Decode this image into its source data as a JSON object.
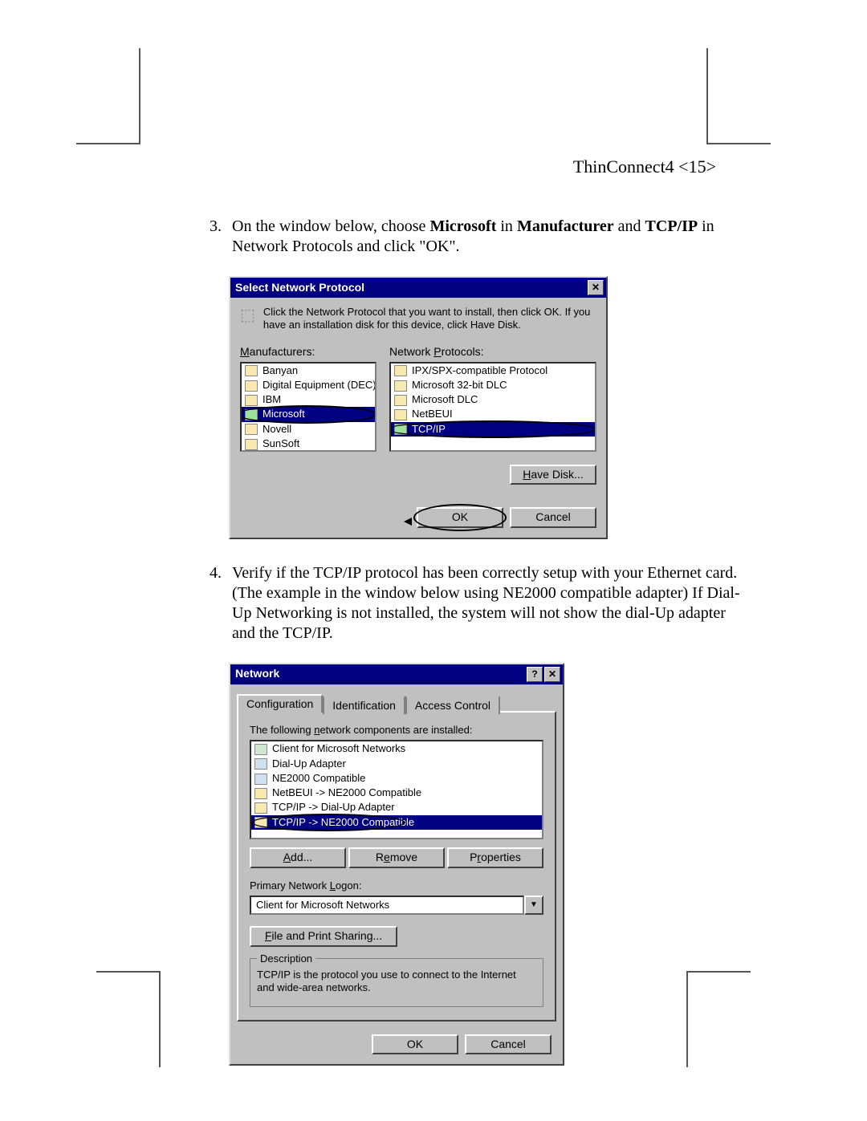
{
  "header": "ThinConnect4  <15>",
  "step3": {
    "num": "3.",
    "text_before": "On the window below, choose ",
    "bold1": "Microsoft",
    "text_mid1": " in ",
    "bold2": "Manufacturer",
    "text_mid2": " and ",
    "bold3": "TCP/IP",
    "text_mid3": " in Network Protocols and click \"OK\"."
  },
  "step4": {
    "text": "Verify if the TCP/IP protocol has been correctly setup with your Ethernet card.   (The example in the window below using NE2000 compatible adapter) If Dial-Up Networking is not installed, the system will not show the dial-Up adapter and the TCP/IP."
  },
  "dlg1": {
    "title": "Select Network Protocol",
    "hint": "Click the Network Protocol that you want to install, then click OK. If you have an installation disk for this device, click Have Disk.",
    "mfg_label": "Manufacturers:",
    "protocols_label": "Network Protocols:",
    "manufacturers": [
      "Banyan",
      "Digital Equipment (DEC)",
      "IBM",
      "Microsoft",
      "Novell",
      "SunSoft"
    ],
    "protocols": [
      "IPX/SPX-compatible Protocol",
      "Microsoft 32-bit DLC",
      "Microsoft DLC",
      "NetBEUI",
      "TCP/IP"
    ],
    "have_disk": "Have Disk...",
    "ok": "OK",
    "cancel": "Cancel"
  },
  "dlg2": {
    "title": "Network",
    "tabs": [
      "Configuration",
      "Identification",
      "Access Control"
    ],
    "list_label": "The following network components are installed:",
    "components": [
      "Client for Microsoft Networks",
      "Dial-Up Adapter",
      "NE2000 Compatible",
      "NetBEUI -> NE2000 Compatible",
      "TCP/IP -> Dial-Up Adapter",
      "TCP/IP -> NE2000 Compatible"
    ],
    "add": "Add...",
    "remove": "Remove",
    "properties": "Properties",
    "logon_label": "Primary Network Logon:",
    "logon_value": "Client for Microsoft Networks",
    "file_print": "File and Print Sharing...",
    "desc_label": "Description",
    "desc_text": "TCP/IP is the protocol you use to connect to the Internet and wide-area networks.",
    "ok": "OK",
    "cancel": "Cancel"
  }
}
